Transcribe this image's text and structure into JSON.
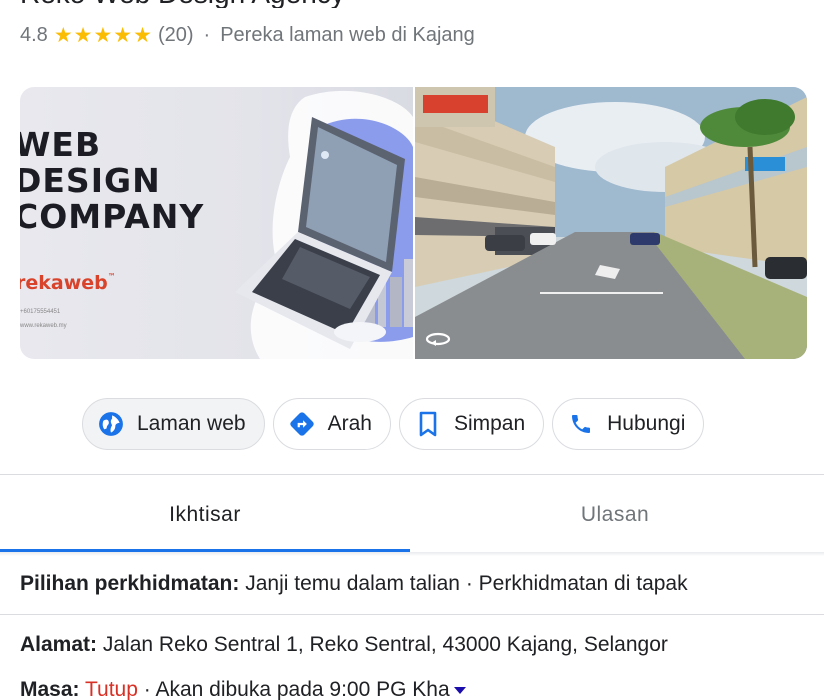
{
  "header": {
    "title_clipped": "Reko Web Design Agency"
  },
  "rating": {
    "score": "4.8",
    "stars": 5,
    "count": "(20)",
    "separator": "·",
    "category": "Pereka laman web di Kajang"
  },
  "photos": {
    "ad_lines": [
      "WEB",
      "DESIGN",
      "COMPANY"
    ],
    "brand": "rekaweb",
    "brand_tm": "™",
    "contact_phone": "+60175554451",
    "contact_site": "www.rekaweb.my"
  },
  "actions": [
    {
      "label": "Laman web",
      "icon": "globe-icon"
    },
    {
      "label": "Arah",
      "icon": "directions-icon"
    },
    {
      "label": "Simpan",
      "icon": "bookmark-icon"
    },
    {
      "label": "Hubungi",
      "icon": "phone-icon"
    }
  ],
  "tabs": [
    {
      "label": "Ikhtisar",
      "selected": true
    },
    {
      "label": "Ulasan",
      "selected": false
    }
  ],
  "details": {
    "service_label": "Pilihan perkhidmatan:",
    "service_value": " Janji temu dalam talian · Perkhidmatan di tapak",
    "address_label": "Alamat:",
    "address_value": " Jalan Reko Sentral 1, Reko Sentral, 43000 Kajang, Selangor",
    "hours_label": "Masa:",
    "hours_status": "Tutup",
    "hours_sep": " · ",
    "hours_value": "Akan dibuka pada 9:00 PG Kha"
  },
  "colors": {
    "star": "#fbbc04",
    "accent": "#1a73e8",
    "closed": "#d93025"
  }
}
